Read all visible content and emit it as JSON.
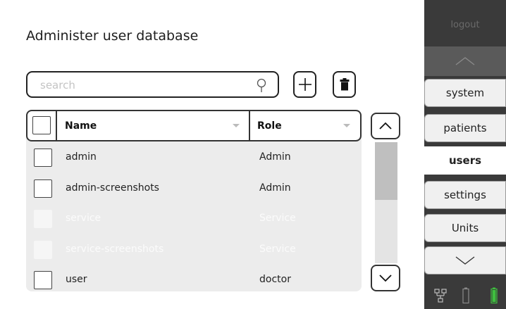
{
  "page": {
    "title": "Administer user database"
  },
  "search": {
    "placeholder": "search",
    "value": ""
  },
  "table": {
    "columns": [
      "Name",
      "Role"
    ],
    "rows": [
      {
        "name": "admin",
        "role": "Admin",
        "enabled": true,
        "checked": false
      },
      {
        "name": "admin-screenshots",
        "role": "Admin",
        "enabled": true,
        "checked": false
      },
      {
        "name": "service",
        "role": "Service",
        "enabled": false,
        "checked": false
      },
      {
        "name": "service-screenshots",
        "role": "Service",
        "enabled": false,
        "checked": false
      },
      {
        "name": "user",
        "role": "doctor",
        "enabled": true,
        "checked": false
      }
    ]
  },
  "sidebar": {
    "logout": "logout",
    "items": [
      {
        "label": "system",
        "active": false
      },
      {
        "label": "patients",
        "active": false
      },
      {
        "label": "users",
        "active": true
      },
      {
        "label": "settings",
        "active": false
      },
      {
        "label": "Units",
        "active": false
      }
    ]
  },
  "icons": {
    "search": "search-icon",
    "add": "plus-icon",
    "delete": "trash-icon",
    "scroll_up": "chevron-up-icon",
    "scroll_down": "chevron-down-icon",
    "network": "network-icon",
    "battery_outline": "battery-empty-icon",
    "battery_full": "battery-full-icon"
  },
  "colors": {
    "sidebar_bg": "#3a3a3a",
    "table_bg": "#ececec",
    "battery_green": "#3fbf3f",
    "disabled_text": "#fbfbfb"
  }
}
